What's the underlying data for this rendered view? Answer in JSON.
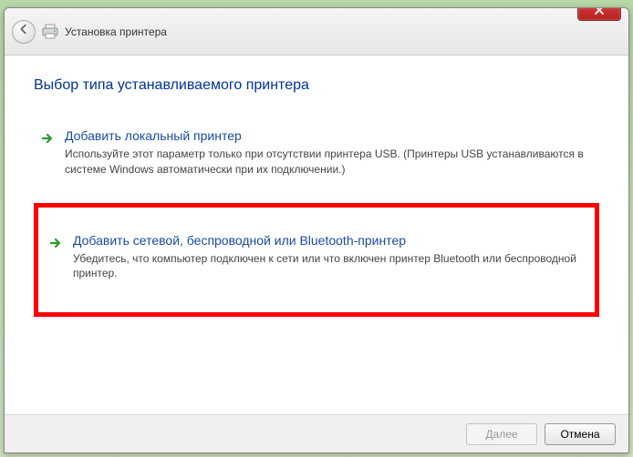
{
  "titlebar": {
    "close_label": "X",
    "title": "Установка принтера"
  },
  "heading": "Выбор типа устанавливаемого принтера",
  "options": [
    {
      "title": "Добавить локальный принтер",
      "desc": "Используйте этот параметр только при отсутствии принтера USB. (Принтеры USB устанавливаются в системе Windows автоматически при их подключении.)"
    },
    {
      "title": "Добавить сетевой, беспроводной или Bluetooth-принтер",
      "desc": "Убедитесь, что компьютер подключен к сети или что включен принтер Bluetooth или беспроводной принтер."
    }
  ],
  "footer": {
    "next": "Далее",
    "cancel": "Отмена"
  }
}
